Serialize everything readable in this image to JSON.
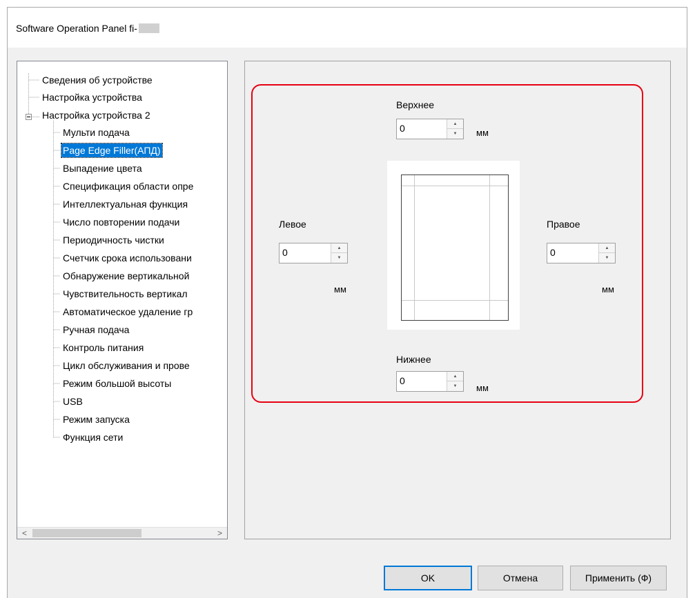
{
  "window": {
    "title": "Software Operation Panel fi-"
  },
  "tree": {
    "items": [
      {
        "label": "Сведения об устройстве"
      },
      {
        "label": "Настройка устройства"
      },
      {
        "label": "Настройка устройства 2"
      },
      {
        "label": "Мульти подача"
      },
      {
        "label": "Page Edge Filler(АПД)"
      },
      {
        "label": "Выпадение цвета"
      },
      {
        "label": "Спецификация области опре"
      },
      {
        "label": "Интеллектуальная функция"
      },
      {
        "label": "Число повторении подачи"
      },
      {
        "label": "Периодичность чистки"
      },
      {
        "label": "Счетчик срока использовани"
      },
      {
        "label": "Обнаружение вертикальной"
      },
      {
        "label": "Чувствительность вертикал"
      },
      {
        "label": "Автоматическое удаление гр"
      },
      {
        "label": "Ручная подача"
      },
      {
        "label": "Контроль питания"
      },
      {
        "label": "Цикл обслуживания и прове"
      },
      {
        "label": "Режим большой высоты"
      },
      {
        "label": "USB"
      },
      {
        "label": "Режим запуска"
      },
      {
        "label": "Функция сети"
      }
    ],
    "scroll_left": "<",
    "scroll_right": ">"
  },
  "edges": {
    "top": {
      "label": "Верхнее",
      "value": "0",
      "unit": "мм"
    },
    "left": {
      "label": "Левое",
      "value": "0",
      "unit": "мм"
    },
    "right": {
      "label": "Правое",
      "value": "0",
      "unit": "мм"
    },
    "bottom": {
      "label": "Нижнее",
      "value": "0",
      "unit": "мм"
    }
  },
  "buttons": {
    "ok": "OK",
    "cancel": "Отмена",
    "apply": "Применить (Ф)"
  },
  "colors": {
    "highlight": "#e60012",
    "selection": "#0078d7"
  }
}
